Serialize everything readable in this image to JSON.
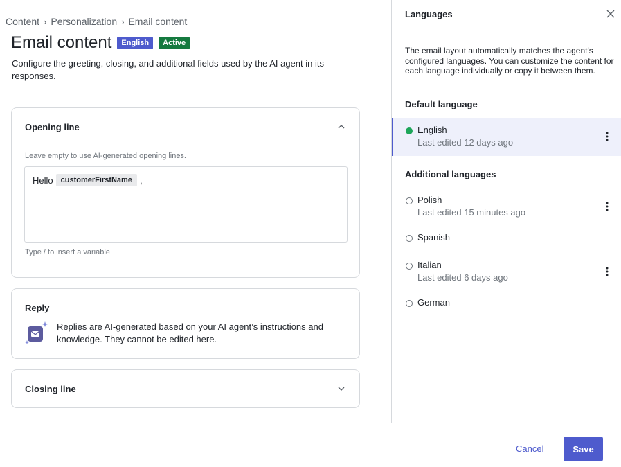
{
  "breadcrumb": [
    "Content",
    "Personalization",
    "Email content"
  ],
  "page": {
    "title": "Email content",
    "language_badge": "English",
    "status_badge": "Active",
    "subtitle": "Configure the greeting, closing, and additional fields used by the AI agent in its responses."
  },
  "opening": {
    "title": "Opening line",
    "hint": "Leave empty to use AI-generated opening lines.",
    "editor_prefix": "Hello",
    "variable": "customerFirstName",
    "editor_suffix": ",",
    "footer_hint": "Type / to insert a variable"
  },
  "reply": {
    "title": "Reply",
    "text": "Replies are AI-generated based on your AI agent’s instructions and knowledge. They cannot be edited here."
  },
  "closing": {
    "title": "Closing line"
  },
  "languages_panel": {
    "title": "Languages",
    "description": "The email layout automatically matches the agent's configured languages. You can customize the content for each language individually or copy it between them.",
    "default_label": "Default language",
    "additional_label": "Additional languages",
    "default": {
      "name": "English",
      "meta": "Last edited 12 days ago"
    },
    "additional": [
      {
        "name": "Polish",
        "meta": "Last edited 15 minutes ago"
      },
      {
        "name": "Spanish",
        "meta": ""
      },
      {
        "name": "Italian",
        "meta": "Last edited 6 days ago"
      },
      {
        "name": "German",
        "meta": ""
      }
    ]
  },
  "footer": {
    "cancel_label": "Cancel",
    "save_label": "Save"
  },
  "colors": {
    "accent": "#4e5bcd",
    "active_badge": "#157a3f",
    "default_dot": "#1ea65a"
  }
}
